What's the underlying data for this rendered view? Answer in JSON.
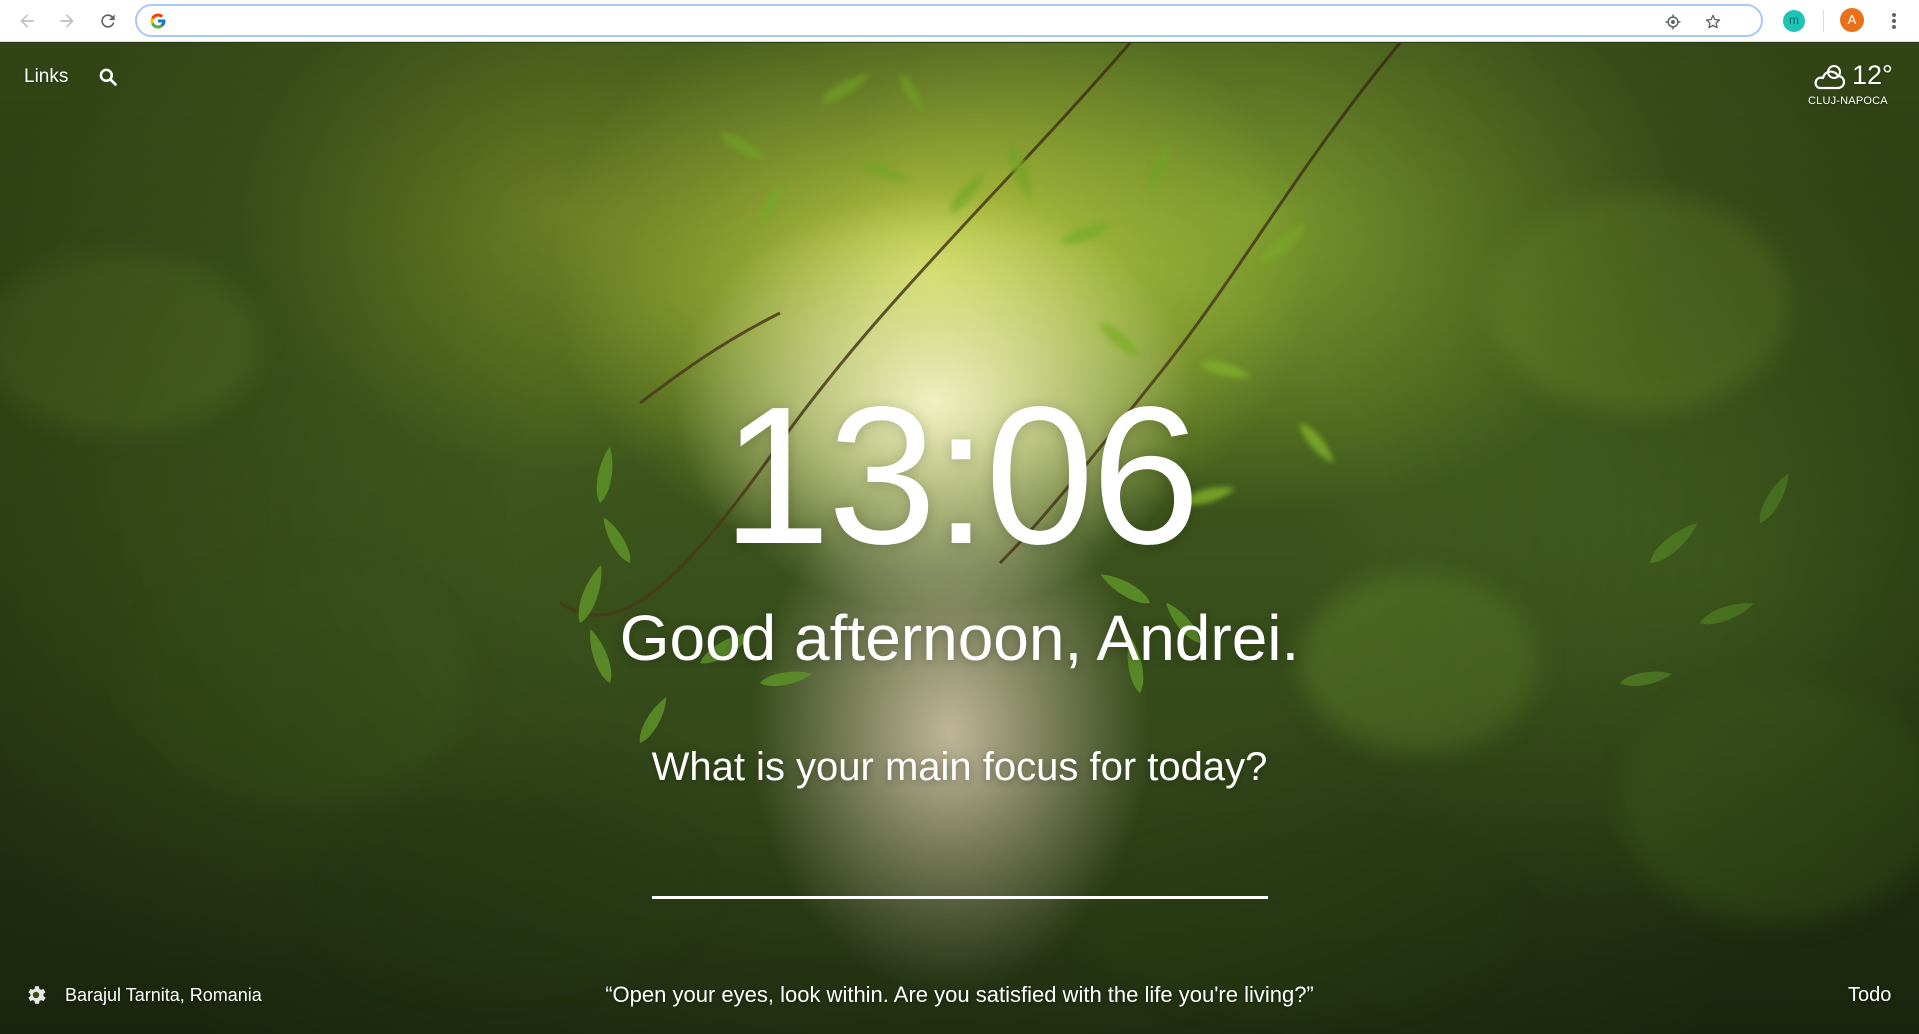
{
  "browser": {
    "omnibox": {
      "value": "",
      "placeholder": ""
    },
    "extension_letter": "m",
    "profile_initial": "A",
    "colors": {
      "omnibox_focus": "#a8c7fa",
      "profile": "#e8711a",
      "extension": "#1fc3b5"
    }
  },
  "top_left": {
    "links_label": "Links"
  },
  "weather": {
    "temperature": "12°",
    "city": "CLUJ-NAPOCA",
    "icon": "partly-cloudy-icon"
  },
  "center": {
    "time": "13:06",
    "greeting": "Good afternoon, Andrei.",
    "focus_question": "What is your main focus for today?",
    "focus_value": ""
  },
  "bottom": {
    "photo_location": "Barajul Tarnita, Romania",
    "quote": "“Open your eyes, look within. Are you satisfied with the life you're living?”",
    "todo_label": "Todo"
  }
}
